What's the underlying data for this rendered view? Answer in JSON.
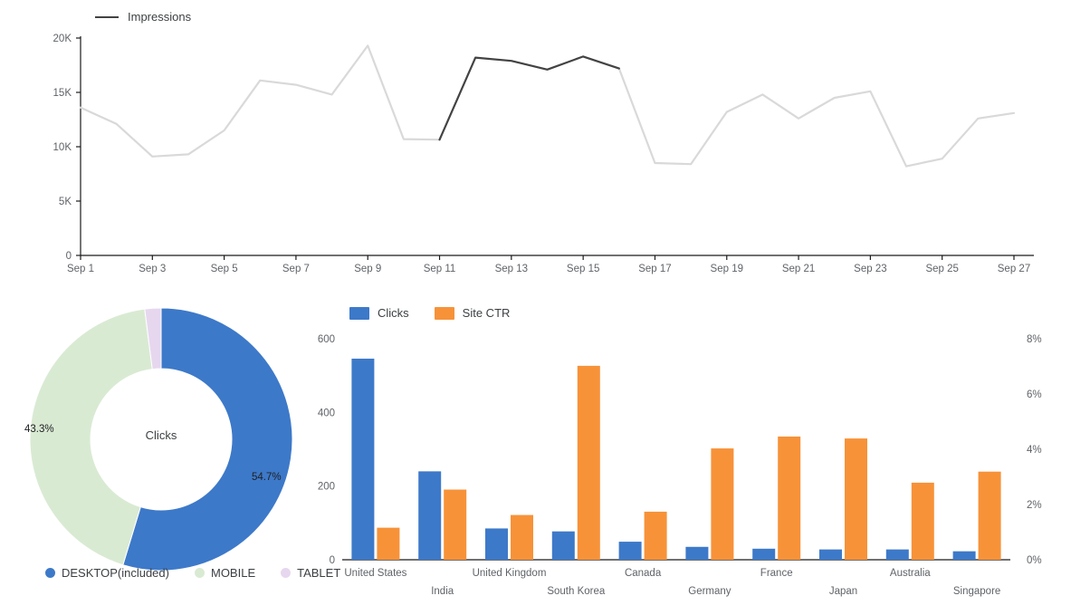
{
  "chart_data": [
    {
      "type": "line",
      "title": "",
      "xlabel": "",
      "ylabel": "",
      "legend": [
        {
          "name": "Impressions",
          "color": "#434343"
        }
      ],
      "legend_position": "top-left",
      "grid": false,
      "ylim": [
        0,
        20000
      ],
      "yticks": [
        "0",
        "5K",
        "10K",
        "15K",
        "20K"
      ],
      "ytick_values": [
        0,
        5000,
        10000,
        15000,
        20000
      ],
      "xticks": [
        "Sep 1",
        "Sep 3",
        "Sep 5",
        "Sep 7",
        "Sep 9",
        "Sep 11",
        "Sep 13",
        "Sep 15",
        "Sep 17",
        "Sep 19",
        "Sep 21",
        "Sep 23",
        "Sep 25",
        "Sep 27"
      ],
      "x": [
        "Sep 1",
        "Sep 2",
        "Sep 3",
        "Sep 4",
        "Sep 5",
        "Sep 6",
        "Sep 7",
        "Sep 8",
        "Sep 9",
        "Sep 10",
        "Sep 11",
        "Sep 12",
        "Sep 13",
        "Sep 14",
        "Sep 15",
        "Sep 16",
        "Sep 17",
        "Sep 18",
        "Sep 19",
        "Sep 20",
        "Sep 21",
        "Sep 22",
        "Sep 23",
        "Sep 24",
        "Sep 25",
        "Sep 26",
        "Sep 27"
      ],
      "series": [
        {
          "name": "Impressions",
          "values": [
            13600,
            12100,
            9100,
            9300,
            11500,
            16100,
            15700,
            14800,
            19300,
            10700,
            10650,
            18200,
            17900,
            17100,
            18300,
            17200,
            8500,
            8400,
            13200,
            14800,
            12600,
            14500,
            15100,
            8200,
            8900,
            12600,
            13100
          ]
        }
      ],
      "highlight_segment": {
        "color": "#434343",
        "from": "Sep 11",
        "to": "Sep 16",
        "base_color": "#d9d9d9"
      }
    },
    {
      "type": "pie",
      "subtype": "donut",
      "center_label": "Clicks",
      "labels": [
        "DESKTOP(included)",
        "MOBILE",
        "TABLET"
      ],
      "values": [
        54.7,
        43.3,
        2.0
      ],
      "value_labels": [
        "54.7%",
        "43.3%",
        ""
      ],
      "colors": [
        "#3d79c9",
        "#d9ead3",
        "#e6d7ef"
      ],
      "legend_position": "bottom"
    },
    {
      "type": "bar",
      "title": "",
      "grid": false,
      "legend_position": "top-left",
      "categories": [
        "United States",
        "India",
        "United Kingdom",
        "South Korea",
        "Canada",
        "Germany",
        "France",
        "Japan",
        "Australia",
        "Singapore"
      ],
      "series": [
        {
          "name": "Clicks",
          "color": "#3d79c9",
          "axis": "left",
          "values": [
            546,
            240,
            85,
            77,
            49,
            35,
            30,
            28,
            28,
            23
          ]
        },
        {
          "name": "Site CTR",
          "color": "#f79239",
          "axis": "right",
          "values": [
            1.16,
            2.54,
            1.62,
            7.02,
            1.74,
            4.03,
            4.46,
            4.39,
            2.79,
            3.19
          ]
        }
      ],
      "left_axis": {
        "label": "",
        "ylim": [
          0,
          600
        ],
        "ticks": [
          "0",
          "200",
          "400",
          "600"
        ],
        "tick_values": [
          0,
          200,
          400,
          600
        ]
      },
      "right_axis": {
        "label": "",
        "ylim": [
          0,
          8
        ],
        "ticks": [
          "0%",
          "2%",
          "4%",
          "6%",
          "8%"
        ],
        "tick_values": [
          0,
          2,
          4,
          6,
          8
        ]
      }
    }
  ],
  "line_chart": {
    "legend_label": "Impressions",
    "yticks": [
      "20K",
      "15K",
      "10K",
      "5K",
      "0"
    ],
    "xticks": [
      "Sep 1",
      "Sep 3",
      "Sep 5",
      "Sep 7",
      "Sep 9",
      "Sep 11",
      "Sep 13",
      "Sep 15",
      "Sep 17",
      "Sep 19",
      "Sep 21",
      "Sep 23",
      "Sep 25",
      "Sep 27"
    ]
  },
  "donut_chart": {
    "center_label": "Clicks",
    "slice_labels": [
      "54.7%",
      "43.3%"
    ],
    "legend": [
      {
        "label": "DESKTOP(included)",
        "color": "#3d79c9"
      },
      {
        "label": "MOBILE",
        "color": "#d9ead3"
      },
      {
        "label": "TABLET",
        "color": "#e6d7ef"
      }
    ]
  },
  "bar_chart": {
    "legend": [
      {
        "label": "Clicks",
        "color": "#3d79c9"
      },
      {
        "label": "Site CTR",
        "color": "#f79239"
      }
    ],
    "left_ticks": [
      "600",
      "400",
      "200",
      "0"
    ],
    "right_ticks": [
      "8%",
      "6%",
      "4%",
      "2%",
      "0%"
    ],
    "categories": [
      "United States",
      "India",
      "United Kingdom",
      "South Korea",
      "Canada",
      "Germany",
      "France",
      "Japan",
      "Australia",
      "Singapore"
    ]
  },
  "colors": {
    "blue": "#3d79c9",
    "orange": "#f79239",
    "green": "#d9ead3",
    "purple": "#e6d7ef",
    "line_light": "#d9d9d9",
    "line_dark": "#434343",
    "axis": "#1a1a1a",
    "text": "#5f6368"
  }
}
